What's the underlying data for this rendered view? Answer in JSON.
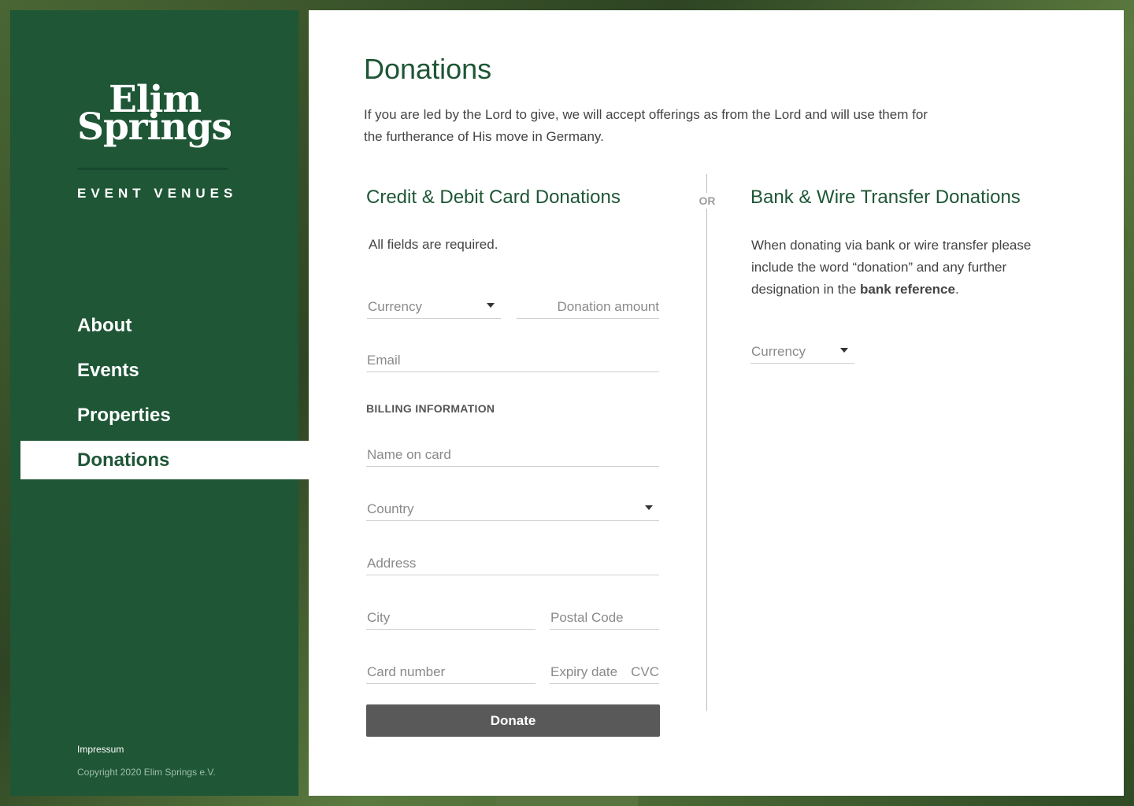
{
  "sidebar": {
    "logo": {
      "line1": "Elim",
      "line2": "Springs",
      "subtitle": "EVENT VENUES"
    },
    "nav": [
      {
        "label": "About"
      },
      {
        "label": "Events"
      },
      {
        "label": "Properties"
      },
      {
        "label": "Donations",
        "active": true
      }
    ],
    "footer": {
      "impressum": "Impressum",
      "copyright": "Copyright 2020 Elim Springs e.V."
    }
  },
  "main": {
    "title": "Donations",
    "intro": "If you are led by the Lord to give, we will accept offerings as from the Lord and will use them for the furtherance of His move in Germany.",
    "divider_label": "OR",
    "card": {
      "title": "Credit & Debit Card Donations",
      "note": "All fields are required.",
      "currency_placeholder": "Currency",
      "amount_placeholder": "Donation amount",
      "email_placeholder": "Email",
      "billing_label": "BILLING INFORMATION",
      "name_placeholder": "Name on card",
      "country_placeholder": "Country",
      "address_placeholder": "Address",
      "city_placeholder": "City",
      "postal_placeholder": "Postal Code",
      "card_number_placeholder": "Card number",
      "expiry_placeholder": "Expiry date",
      "cvc_placeholder": "CVC",
      "donate_label": "Donate"
    },
    "bank": {
      "title": "Bank & Wire Transfer Donations",
      "text_before": "When donating via bank or wire transfer please include the word “donation” and any further designation in the ",
      "text_bold": "bank reference",
      "text_after": ".",
      "currency_placeholder": "Currency"
    }
  },
  "colors": {
    "brand_green": "#1e5636",
    "button_gray": "#595959"
  }
}
